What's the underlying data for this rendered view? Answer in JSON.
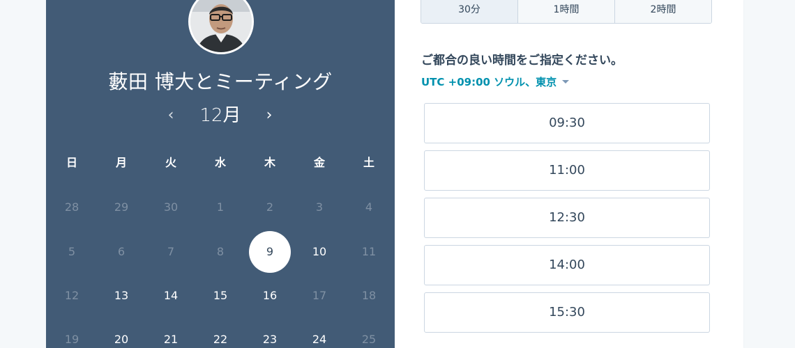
{
  "meeting": {
    "title": "藪田 博大とミーティング"
  },
  "calendar": {
    "month": "12月",
    "weekdays": [
      "日",
      "月",
      "火",
      "水",
      "木",
      "金",
      "土"
    ],
    "weeks": [
      [
        {
          "d": "28",
          "s": "disabled"
        },
        {
          "d": "29",
          "s": "disabled"
        },
        {
          "d": "30",
          "s": "disabled"
        },
        {
          "d": "1",
          "s": "disabled"
        },
        {
          "d": "2",
          "s": "disabled"
        },
        {
          "d": "3",
          "s": "disabled"
        },
        {
          "d": "4",
          "s": "disabled"
        }
      ],
      [
        {
          "d": "5",
          "s": "disabled"
        },
        {
          "d": "6",
          "s": "disabled"
        },
        {
          "d": "7",
          "s": "disabled"
        },
        {
          "d": "8",
          "s": "disabled"
        },
        {
          "d": "9",
          "s": "selected"
        },
        {
          "d": "10",
          "s": "available"
        },
        {
          "d": "11",
          "s": "disabled"
        }
      ],
      [
        {
          "d": "12",
          "s": "disabled"
        },
        {
          "d": "13",
          "s": "available"
        },
        {
          "d": "14",
          "s": "available"
        },
        {
          "d": "15",
          "s": "available"
        },
        {
          "d": "16",
          "s": "available"
        },
        {
          "d": "17",
          "s": "disabled"
        },
        {
          "d": "18",
          "s": "disabled"
        }
      ],
      [
        {
          "d": "19",
          "s": "disabled"
        },
        {
          "d": "20",
          "s": "available"
        },
        {
          "d": "21",
          "s": "available"
        },
        {
          "d": "22",
          "s": "available"
        },
        {
          "d": "23",
          "s": "available"
        },
        {
          "d": "24",
          "s": "available"
        },
        {
          "d": "25",
          "s": "disabled"
        }
      ]
    ]
  },
  "durations": [
    {
      "label": "30分",
      "active": true
    },
    {
      "label": "1時間",
      "active": false
    },
    {
      "label": "2時間",
      "active": false
    }
  ],
  "prompt": "ご都合の良い時間をご指定ください。",
  "timezone": "UTC +09:00 ソウル、東京",
  "slots": [
    "09:30",
    "11:00",
    "12:30",
    "14:00",
    "15:30"
  ],
  "colors": {
    "panel": "#425b76",
    "accent": "#0091ae",
    "text": "#33475b"
  },
  "icons": {
    "prev": "chevron-left-icon",
    "next": "chevron-right-icon",
    "dropdown": "caret-down-icon"
  }
}
